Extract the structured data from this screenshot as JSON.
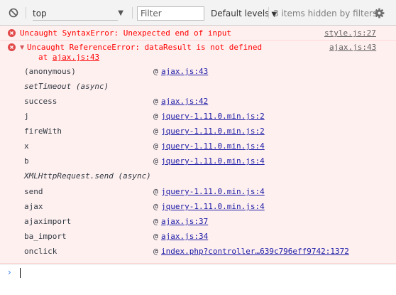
{
  "toolbar": {
    "context": "top",
    "filter_placeholder": "Filter",
    "levels_label": "Default levels",
    "hidden_info": "3 items hidden by filters"
  },
  "icons": {
    "clear": "clear-console-icon",
    "context_dropdown": "caret-down-icon",
    "levels_dropdown": "caret-down-icon",
    "settings": "gear-icon",
    "error": "error-icon",
    "expand": "expand-triangle-icon",
    "prompt": "chevron-right-icon"
  },
  "colors": {
    "error_text": "#ff0000",
    "error_background": "#fff0f0",
    "link": "#1a1aa6",
    "prompt": "#367cf1"
  },
  "messages": [
    {
      "text": "Uncaught SyntaxError: Unexpected end of input",
      "source": "style.js:27"
    },
    {
      "text": "Uncaught ReferenceError: dataResult is not defined",
      "continuation_prefix": "at ",
      "continuation_link": "ajax.js:43",
      "source": "ajax.js:43",
      "stack": [
        {
          "name": "(anonymous)",
          "at": "@",
          "link": "ajax.js:43"
        },
        {
          "name": "setTimeout (async)"
        },
        {
          "name": "success",
          "at": "@",
          "link": "ajax.js:42"
        },
        {
          "name": "j",
          "at": "@",
          "link": "jquery-1.11.0.min.js:2"
        },
        {
          "name": "fireWith",
          "at": "@",
          "link": "jquery-1.11.0.min.js:2"
        },
        {
          "name": "x",
          "at": "@",
          "link": "jquery-1.11.0.min.js:4"
        },
        {
          "name": "b",
          "at": "@",
          "link": "jquery-1.11.0.min.js:4"
        },
        {
          "name": "XMLHttpRequest.send (async)"
        },
        {
          "name": "send",
          "at": "@",
          "link": "jquery-1.11.0.min.js:4"
        },
        {
          "name": "ajax",
          "at": "@",
          "link": "jquery-1.11.0.min.js:4"
        },
        {
          "name": "ajaximport",
          "at": "@",
          "link": "ajax.js:37"
        },
        {
          "name": "ba_import",
          "at": "@",
          "link": "ajax.js:34"
        },
        {
          "name": "onclick",
          "at": "@",
          "link": "index.php?controller…639c796eff9742:1372"
        }
      ]
    }
  ]
}
